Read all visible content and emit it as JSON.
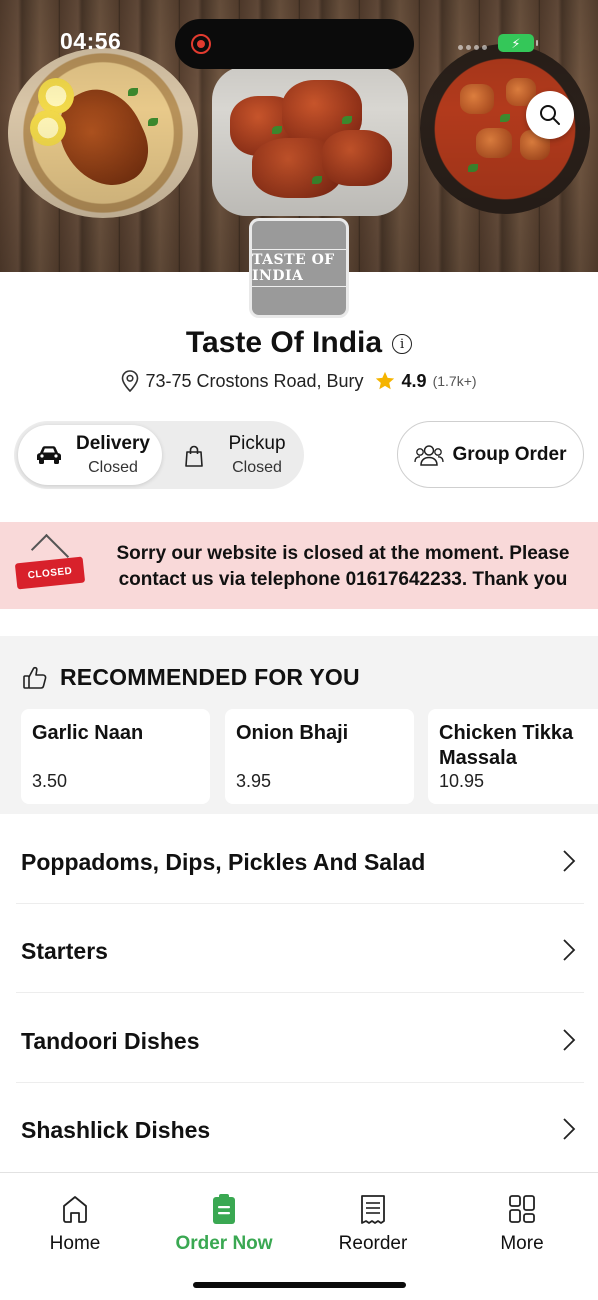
{
  "status_bar": {
    "time": "04:56"
  },
  "restaurant": {
    "logo_text": "TASTE OF INDIA",
    "name": "Taste Of India",
    "address": "73-75 Crostons Road, Bury",
    "rating": "4.9",
    "rating_count": "(1.7k+)"
  },
  "order_mode": {
    "delivery": {
      "label": "Delivery",
      "status": "Closed"
    },
    "pickup": {
      "label": "Pickup",
      "status": "Closed"
    },
    "group_order_label": "Group Order"
  },
  "closed_banner": {
    "sign_text": "CLOSED",
    "line1": "Sorry our website is closed at the moment. Please",
    "line2": "contact us via telephone 01617642233. Thank you"
  },
  "recommended": {
    "title": "RECOMMENDED FOR YOU",
    "items": [
      {
        "name": "Garlic Naan",
        "price": "3.50"
      },
      {
        "name": "Onion Bhaji",
        "price": "3.95"
      },
      {
        "name": "Chicken Tikka Massala",
        "price": "10.95"
      }
    ]
  },
  "categories": [
    "Poppadoms, Dips, Pickles And Salad",
    "Starters",
    "Tandoori Dishes",
    "Shashlick Dishes"
  ],
  "bottom_nav": [
    {
      "label": "Home",
      "icon": "home-icon",
      "active": false
    },
    {
      "label": "Order Now",
      "icon": "order-bag-icon",
      "active": true
    },
    {
      "label": "Reorder",
      "icon": "receipt-icon",
      "active": false
    },
    {
      "label": "More",
      "icon": "grid-icon",
      "active": false
    }
  ],
  "colors": {
    "accent_green": "#3aa852",
    "banner_bg": "#f9d9d9",
    "closed_red": "#d8212b",
    "star": "#f5b400"
  }
}
